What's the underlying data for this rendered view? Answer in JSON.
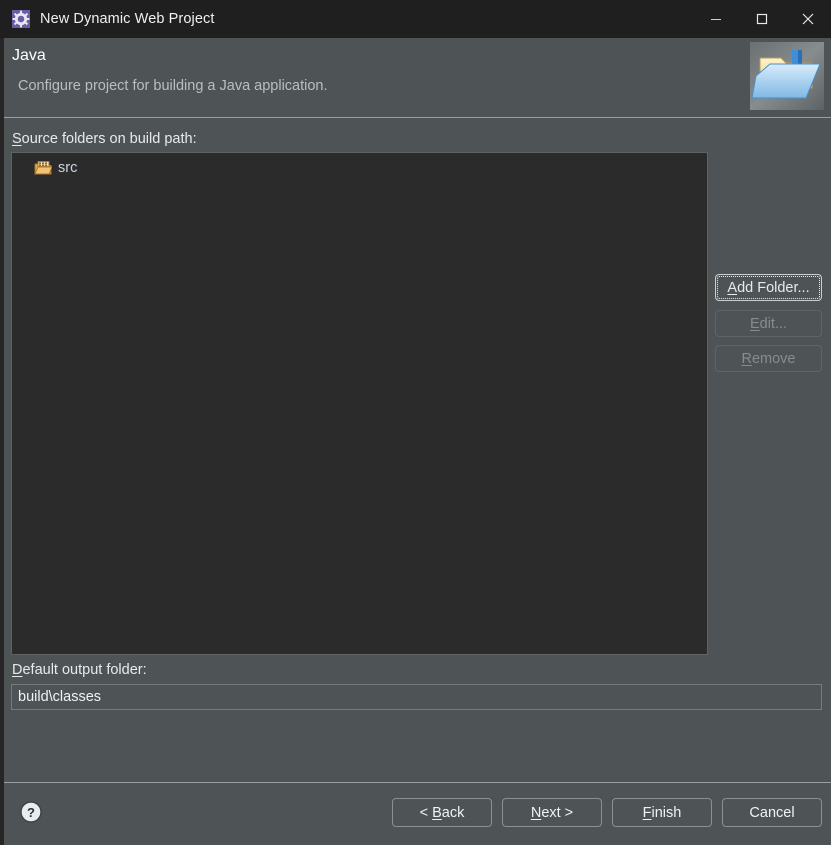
{
  "window": {
    "title": "New Dynamic Web Project",
    "app_icon": "eclipse-wizard-gear-icon",
    "controls": {
      "minimize": "Minimize",
      "maximize": "Maximize",
      "close": "Close"
    }
  },
  "header": {
    "title": "Java",
    "subtitle": "Configure project for building a Java application.",
    "icon": "java-folder-wizard-icon"
  },
  "main": {
    "source_folders": {
      "label": "Source folders on build path:",
      "label_mnemonic": "S",
      "items": [
        {
          "name": "src",
          "icon": "source-folder-icon"
        }
      ]
    },
    "side_buttons": [
      {
        "label": "Add Folder...",
        "mnemonic": "A",
        "enabled": true,
        "focused": true
      },
      {
        "label": "Edit...",
        "mnemonic": "E",
        "enabled": false,
        "focused": false
      },
      {
        "label": "Remove",
        "mnemonic": "R",
        "enabled": false,
        "focused": false
      }
    ],
    "output_folder": {
      "label": "Default output folder:",
      "label_mnemonic": "D",
      "value": "build\\classes",
      "placeholder": ""
    }
  },
  "footer": {
    "help": "?",
    "buttons": [
      {
        "label": "< Back",
        "mnemonic": "B",
        "enabled": true
      },
      {
        "label": "Next >",
        "mnemonic": "N",
        "enabled": true
      },
      {
        "label": "Finish",
        "mnemonic": "F",
        "enabled": true
      },
      {
        "label": "Cancel",
        "mnemonic": "C",
        "enabled": true
      }
    ]
  },
  "colors": {
    "dialog_bg": "#4e5456",
    "titlebar_bg": "#1f1f1f",
    "listbox_bg": "#2b2b2b",
    "text": "#e8eaea",
    "subtext": "#b9bec0",
    "disabled_text": "#878d8f",
    "separator": "#9aa0a2",
    "tree_label": "#cdd3e0"
  }
}
